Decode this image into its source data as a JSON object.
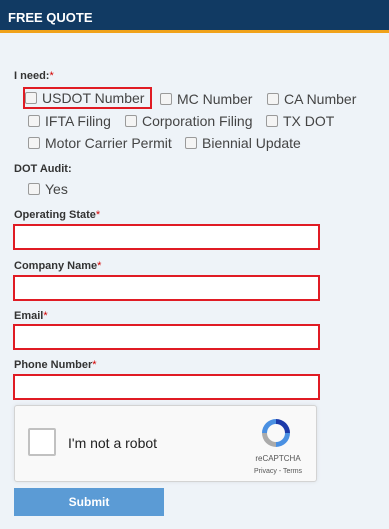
{
  "header": {
    "title": "FREE QUOTE"
  },
  "form": {
    "need_label": "I need:",
    "required_mark": "*",
    "need_options": [
      {
        "label": "USDOT Number",
        "checked": false,
        "highlighted": true
      },
      {
        "label": "MC Number",
        "checked": false
      },
      {
        "label": "CA Number",
        "checked": false
      },
      {
        "label": "IFTA Filing",
        "checked": false
      },
      {
        "label": "Corporation Filing",
        "checked": false
      },
      {
        "label": "TX DOT",
        "checked": false
      },
      {
        "label": "Motor Carrier Permit",
        "checked": false
      },
      {
        "label": "Biennial Update",
        "checked": false
      }
    ],
    "audit_label": "DOT Audit:",
    "audit_option": {
      "label": "Yes",
      "checked": false
    },
    "fields": {
      "state": {
        "label": "Operating State",
        "value": ""
      },
      "company": {
        "label": "Company Name",
        "value": ""
      },
      "email": {
        "label": "Email",
        "value": ""
      },
      "phone": {
        "label": "Phone Number",
        "value": ""
      }
    },
    "captcha": {
      "label": "I'm not a robot",
      "brand": "reCAPTCHA",
      "privacy": "Privacy",
      "separator": " - ",
      "terms": "Terms"
    },
    "submit_label": "Submit"
  },
  "colors": {
    "header_bg": "#113a63",
    "accent": "#f0a21a",
    "error_border": "#e01b24",
    "button": "#5b9bd5"
  }
}
